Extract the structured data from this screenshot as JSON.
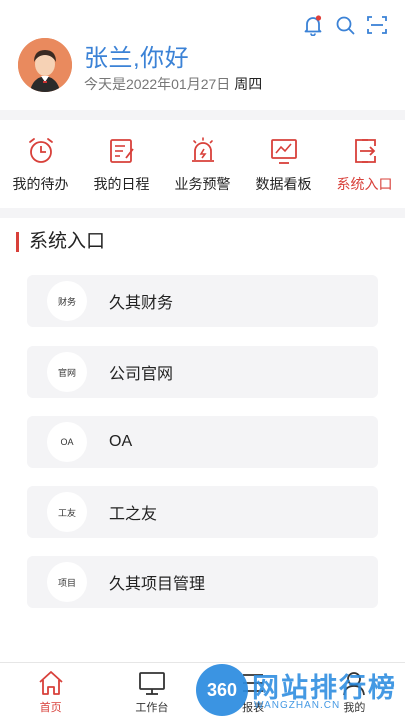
{
  "header": {
    "greeting": "张兰,你好",
    "date": "今天是2022年01月27日",
    "weekday": "周四",
    "icons": [
      "bell-icon",
      "search-icon",
      "scan-icon"
    ]
  },
  "quick_actions": [
    {
      "label": "我的待办",
      "icon": "alarm-clock-icon"
    },
    {
      "label": "我的日程",
      "icon": "schedule-icon"
    },
    {
      "label": "业务预警",
      "icon": "warning-light-icon"
    },
    {
      "label": "数据看板",
      "icon": "dashboard-chart-icon"
    },
    {
      "label": "系统入口",
      "icon": "system-entry-icon",
      "active": true
    }
  ],
  "section": {
    "title": "系统入口",
    "entries": [
      {
        "badge": "财务",
        "label": "久其财务"
      },
      {
        "badge": "官网",
        "label": "公司官网"
      },
      {
        "badge": "OA",
        "label": "OA"
      },
      {
        "badge": "工友",
        "label": "工之友"
      },
      {
        "badge": "项目",
        "label": "久其项目管理"
      }
    ]
  },
  "tabbar": [
    {
      "label": "首页",
      "icon": "home-icon",
      "active": true
    },
    {
      "label": "工作台",
      "icon": "monitor-icon"
    },
    {
      "label": "报表",
      "icon": "report-icon"
    },
    {
      "label": "我的",
      "icon": "user-icon"
    }
  ],
  "watermark": {
    "logo": "360",
    "text": "网站排行榜",
    "sub": "WANGZHAN.CN"
  },
  "colors": {
    "accent": "#d8403a",
    "greeting": "#3b82d6",
    "background": "#f4f4f6"
  }
}
